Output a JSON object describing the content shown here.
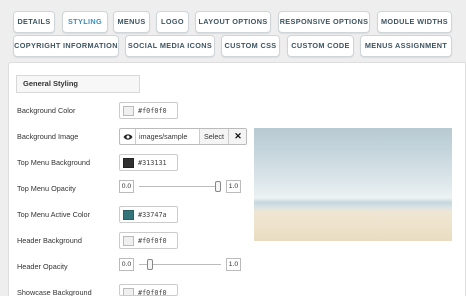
{
  "tabs": [
    {
      "label": "Details",
      "active": false
    },
    {
      "label": "Styling",
      "active": true
    },
    {
      "label": "Menus",
      "active": false
    },
    {
      "label": "Logo",
      "active": false
    },
    {
      "label": "Layout Options",
      "active": false
    },
    {
      "label": "Responsive Options",
      "active": false
    },
    {
      "label": "Module Widths",
      "active": false
    },
    {
      "label": "Copyright Information",
      "active": false
    },
    {
      "label": "Social Media Icons",
      "active": false
    },
    {
      "label": "Custom CSS",
      "active": false
    },
    {
      "label": "Custom Code",
      "active": false
    },
    {
      "label": "Menus Assignment",
      "active": false
    }
  ],
  "section": {
    "title": "General Styling"
  },
  "fields": {
    "background_color": {
      "label": "Background Color",
      "value": "#f0f0f0"
    },
    "background_image": {
      "label": "Background Image",
      "path": "images/sample",
      "select_label": "Select",
      "clear_label": "✕",
      "eye_icon": "eye-icon"
    },
    "top_menu_background": {
      "label": "Top Menu Background",
      "value": "#313131"
    },
    "top_menu_opacity": {
      "label": "Top Menu Opacity",
      "min": "0.0",
      "max": "1.0",
      "level": 1.0
    },
    "top_menu_active_color": {
      "label": "Top Menu Active Color",
      "value": "#33747a"
    },
    "header_background": {
      "label": "Header Background",
      "value": "#f0f0f0"
    },
    "header_opacity": {
      "label": "Header Opacity",
      "min": "0.0",
      "max": "1.0",
      "level": 0.1
    },
    "showcase_background": {
      "label": "Showcase Background",
      "value": "#f0f0f0"
    }
  },
  "colors": {
    "active_tab": "#3a8fc4",
    "tab_text": "#3d5563"
  }
}
